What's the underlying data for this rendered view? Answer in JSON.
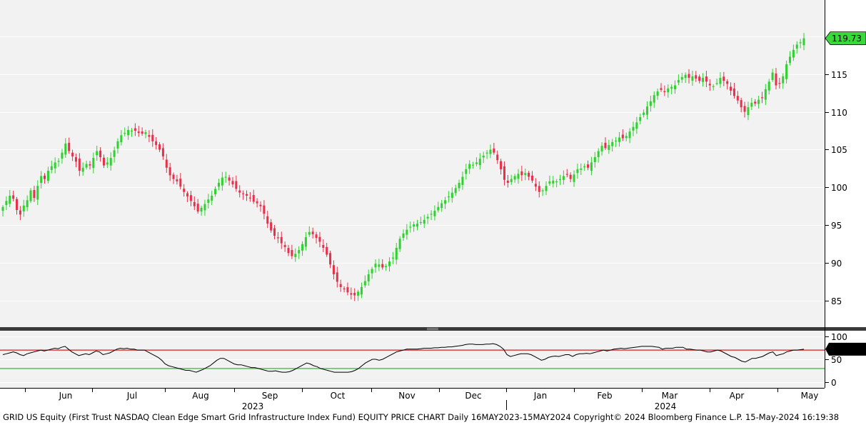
{
  "footer": {
    "text": "GRID US Equity (First Trust NASDAQ Clean Edge Smart Grid Infrastructure Index Fund) EQUITY PRICE CHART  Daily 16MAY2023-15MAY2024  Copyright© 2024 Bloomberg Finance L.P.  15-May-2024 16:19:38"
  },
  "colors": {
    "up": "#2fd12f",
    "down": "#e8304a",
    "background": "#f2f2f2",
    "grid": "#ffffff",
    "rsi_line": "#000000",
    "overbought_line": "#d62020",
    "oversold_line": "#2fbf2f",
    "last_price_badge": "#3bd83b"
  },
  "chart_data": [
    {
      "type": "candlestick",
      "title": "",
      "ylim": [
        81.5,
        124.8
      ],
      "yticks": [
        85,
        90,
        95,
        100,
        105,
        110,
        115
      ],
      "y_axis_side": "right",
      "grid": true,
      "last_value_label": "119.73",
      "last_value": 119.73,
      "x_months": [
        "Jun",
        "Jul",
        "Aug",
        "Sep",
        "Oct",
        "Nov",
        "Dec",
        "Jan",
        "Feb",
        "Mar",
        "Apr",
        "May"
      ],
      "x_years": [
        "2023",
        "2024"
      ],
      "series_close": [
        97.4,
        98.2,
        98.9,
        98.5,
        97.0,
        96.4,
        97.6,
        98.3,
        99.6,
        98.6,
        100.2,
        101.5,
        101.1,
        102.2,
        102.8,
        103.3,
        103.5,
        104.6,
        105.8,
        104.8,
        104.1,
        103.4,
        102.2,
        102.6,
        103.1,
        102.9,
        103.9,
        104.8,
        104.0,
        102.9,
        103.3,
        103.9,
        104.9,
        106.1,
        106.9,
        107.2,
        107.6,
        107.5,
        107.5,
        107.2,
        107.1,
        107.3,
        106.7,
        106.1,
        105.6,
        105.0,
        104.1,
        102.6,
        101.6,
        101.1,
        100.8,
        100.1,
        99.4,
        98.8,
        98.2,
        97.5,
        96.8,
        97.3,
        97.8,
        98.4,
        98.9,
        99.8,
        100.6,
        101.3,
        101.4,
        100.9,
        100.4,
        99.8,
        99.3,
        99.1,
        98.9,
        98.6,
        98.1,
        97.9,
        97.5,
        96.5,
        95.2,
        94.3,
        93.6,
        93.3,
        92.6,
        92.1,
        91.3,
        90.9,
        91.2,
        91.7,
        92.5,
        93.4,
        94.1,
        93.8,
        93.3,
        92.8,
        92.0,
        91.1,
        89.8,
        88.5,
        87.5,
        86.8,
        86.5,
        86.1,
        85.8,
        85.7,
        86.2,
        86.8,
        87.6,
        88.5,
        89.2,
        89.9,
        89.8,
        89.4,
        89.6,
        90.2,
        90.7,
        92.0,
        93.2,
        93.9,
        94.4,
        94.8,
        95.1,
        95.2,
        95.4,
        95.7,
        96.1,
        96.5,
        96.9,
        97.4,
        97.9,
        98.3,
        98.8,
        99.3,
        99.9,
        100.6,
        101.4,
        102.4,
        103.1,
        103.0,
        103.3,
        103.8,
        104.2,
        104.6,
        105.0,
        104.6,
        103.6,
        102.4,
        101.0,
        100.6,
        101.1,
        101.5,
        101.8,
        101.6,
        101.9,
        101.4,
        100.9,
        100.1,
        99.4,
        99.6,
        100.2,
        100.8,
        100.9,
        100.8,
        101.1,
        101.5,
        101.7,
        101.1,
        101.7,
        102.4,
        102.5,
        102.8,
        102.6,
        103.3,
        104.0,
        104.8,
        105.5,
        105.2,
        105.6,
        106.0,
        106.2,
        106.6,
        106.5,
        106.8,
        107.4,
        108.0,
        108.6,
        109.3,
        109.9,
        110.7,
        111.4,
        112.2,
        112.7,
        112.9,
        112.6,
        113.1,
        113.3,
        113.5,
        114.2,
        114.6,
        114.9,
        114.5,
        114.7,
        114.4,
        114.1,
        114.5,
        114.0,
        113.5,
        113.4,
        113.8,
        114.5,
        114.1,
        113.7,
        112.8,
        112.1,
        111.5,
        110.6,
        110.0,
        110.6,
        111.2,
        111.1,
        111.6,
        111.9,
        113.0,
        114.0,
        115.2,
        113.5,
        113.8,
        114.7,
        116.3,
        117.3,
        118.2,
        118.9,
        119.2,
        119.73
      ],
      "series": [
        {
          "values": []
        }
      ]
    },
    {
      "type": "line",
      "title": "",
      "ylim": [
        -12,
        112
      ],
      "yticks": [
        0,
        50,
        100
      ],
      "y_axis_side": "right",
      "overbought": 70,
      "oversold": 30,
      "last_value_label": "71.9199",
      "last_value": 71.9199,
      "series_rsi": [
        60,
        62,
        64,
        66,
        64,
        60,
        58,
        62,
        64,
        66,
        68,
        70,
        68,
        70,
        72,
        74,
        73,
        76,
        78,
        72,
        66,
        62,
        58,
        60,
        62,
        60,
        64,
        68,
        66,
        60,
        62,
        64,
        68,
        72,
        74,
        73,
        74,
        72,
        72,
        70,
        70,
        70,
        66,
        62,
        58,
        54,
        48,
        40,
        36,
        34,
        32,
        30,
        28,
        26,
        26,
        24,
        22,
        25,
        28,
        32,
        36,
        42,
        48,
        52,
        52,
        48,
        44,
        40,
        38,
        38,
        36,
        34,
        32,
        32,
        30,
        28,
        26,
        24,
        24,
        25,
        23,
        22,
        22,
        23,
        26,
        30,
        34,
        38,
        42,
        40,
        36,
        34,
        30,
        28,
        26,
        24,
        22,
        22,
        22,
        22,
        22,
        23,
        26,
        30,
        36,
        42,
        46,
        50,
        50,
        48,
        50,
        54,
        58,
        62,
        66,
        68,
        70,
        72,
        72,
        72,
        72,
        73,
        74,
        74,
        74,
        75,
        75,
        76,
        76,
        77,
        77,
        78,
        79,
        80,
        82,
        83,
        83,
        82,
        82,
        82,
        83,
        83,
        84,
        82,
        78,
        72,
        60,
        56,
        58,
        60,
        62,
        62,
        62,
        60,
        56,
        52,
        48,
        50,
        54,
        56,
        57,
        56,
        58,
        60,
        60,
        56,
        60,
        62,
        62,
        63,
        62,
        64,
        66,
        68,
        70,
        68,
        70,
        72,
        73,
        74,
        73,
        74,
        75,
        76,
        77,
        78,
        78,
        78,
        78,
        77,
        76,
        72,
        74,
        74,
        74,
        76,
        76,
        76,
        72,
        72,
        71,
        70,
        70,
        68,
        66,
        66,
        68,
        70,
        68,
        64,
        60,
        56,
        54,
        50,
        46,
        44,
        48,
        52,
        52,
        54,
        56,
        60,
        64,
        66,
        58,
        60,
        62,
        66,
        68,
        70,
        70,
        71,
        71.9199
      ],
      "series": [
        {
          "values": []
        }
      ]
    }
  ]
}
